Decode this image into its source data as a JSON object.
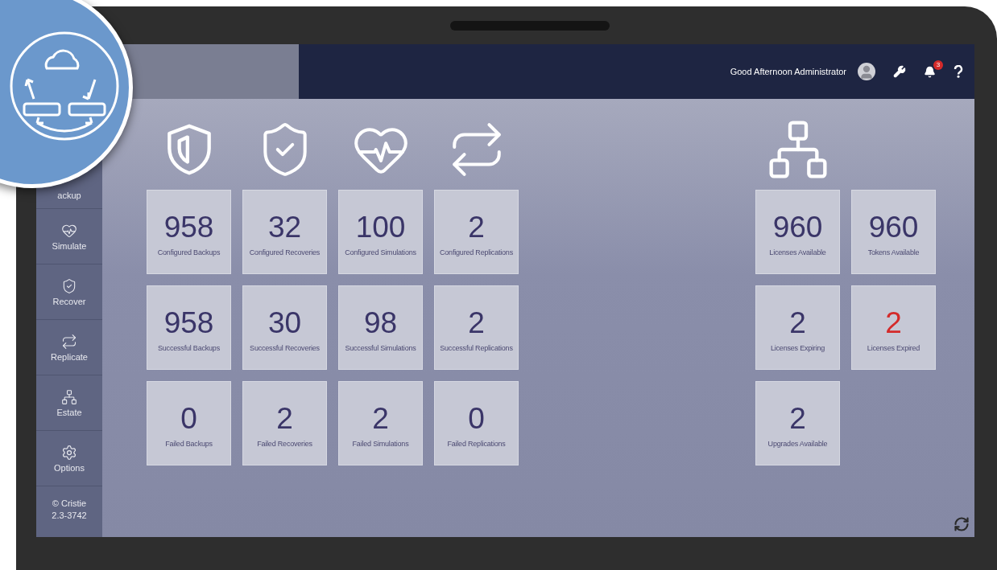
{
  "header": {
    "greeting": "Good Afternoon Administrator",
    "notification_count": "3"
  },
  "sidebar": {
    "items": [
      {
        "label": "ackup"
      },
      {
        "kind": "simulate",
        "label": "Simulate"
      },
      {
        "kind": "recover",
        "label": "Recover"
      },
      {
        "kind": "replicate",
        "label": "Replicate"
      },
      {
        "kind": "estate",
        "label": "Estate"
      },
      {
        "kind": "options",
        "label": "Options"
      }
    ],
    "footer": [
      "© Cristie",
      "2.3-3742"
    ]
  },
  "job_columns": [
    {
      "kind": "backup",
      "tiles": [
        {
          "value": "958",
          "label": "Configured Backups",
          "alert": false
        },
        {
          "value": "958",
          "label": "Successful Backups",
          "alert": false
        },
        {
          "value": "0",
          "label": "Failed Backups",
          "alert": false
        }
      ]
    },
    {
      "kind": "recover",
      "tiles": [
        {
          "value": "32",
          "label": "Configured Recoveries",
          "alert": false
        },
        {
          "value": "30",
          "label": "Successful Recoveries",
          "alert": false
        },
        {
          "value": "2",
          "label": "Failed Recoveries",
          "alert": false
        }
      ]
    },
    {
      "kind": "simulate",
      "tiles": [
        {
          "value": "100",
          "label": "Configured Simulations",
          "alert": false
        },
        {
          "value": "98",
          "label": "Successful Simulations",
          "alert": false
        },
        {
          "value": "2",
          "label": "Failed Simulations",
          "alert": false
        }
      ]
    },
    {
      "kind": "replicate",
      "tiles": [
        {
          "value": "2",
          "label": "Configured Replications",
          "alert": false
        },
        {
          "value": "2",
          "label": "Successful Replications",
          "alert": false
        },
        {
          "value": "0",
          "label": "Failed Replications",
          "alert": false
        }
      ]
    }
  ],
  "estate": {
    "kind": "estate",
    "tiles": [
      {
        "value": "960",
        "label": "Licenses Available",
        "alert": false
      },
      {
        "value": "960",
        "label": "Tokens Available",
        "alert": false
      },
      {
        "value": "2",
        "label": "Licenses Expiring",
        "alert": false
      },
      {
        "value": "2",
        "label": "Licenses Expired",
        "alert": true
      },
      {
        "value": "2",
        "label": "Upgrades Available",
        "alert": false
      }
    ]
  }
}
